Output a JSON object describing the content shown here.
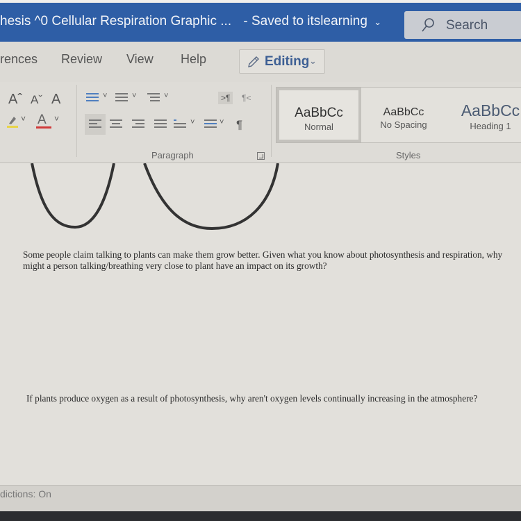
{
  "titlebar": {
    "document_title": "hesis ^0 Cellular Respiration Graphic ...",
    "save_status": "- Saved to itslearning",
    "save_chevron": "⌄",
    "search_label": "Search"
  },
  "menu": {
    "tabs": [
      {
        "label": "rences"
      },
      {
        "label": "Review"
      },
      {
        "label": "View"
      },
      {
        "label": "Help"
      }
    ],
    "mode_button": {
      "label": "Editing",
      "chevron": "⌄"
    }
  },
  "ribbon": {
    "font_group": {
      "grow_font": "Aˆ",
      "shrink_font": "Aˇ",
      "clear_formatting": "A",
      "highlight_color": "#e8d44a",
      "font_color": "#d03a3a",
      "dropdown_chevron": "˅"
    },
    "paragraph_group": {
      "label": "Paragraph",
      "ltr_label": ">¶",
      "rtl_label": "¶<",
      "show_marks": "¶",
      "dropdown_chevron": "˅"
    },
    "styles_group": {
      "label": "Styles",
      "items": [
        {
          "sample": "AaBbCc",
          "name": "Normal",
          "selected": true
        },
        {
          "sample": "AaBbCc",
          "name": "No Spacing",
          "selected": false
        },
        {
          "sample": "AaBbCc",
          "name": "Heading 1",
          "selected": false
        }
      ]
    }
  },
  "document": {
    "questions": [
      {
        "text": "Some people claim talking to plants can make them grow better. Given what you know about photosynthesis and respiration, why might a person talking/breathing very close to plant have an impact on its growth?"
      },
      {
        "text": "If plants produce oxygen as a result of photosynthesis, why aren't oxygen levels continually increasing in the atmosphere?"
      }
    ]
  },
  "statusbar": {
    "text_predictions": "dictions: On"
  },
  "colors": {
    "title_bar": "#2e5ea6",
    "editing_accent": "#3d5f94"
  }
}
